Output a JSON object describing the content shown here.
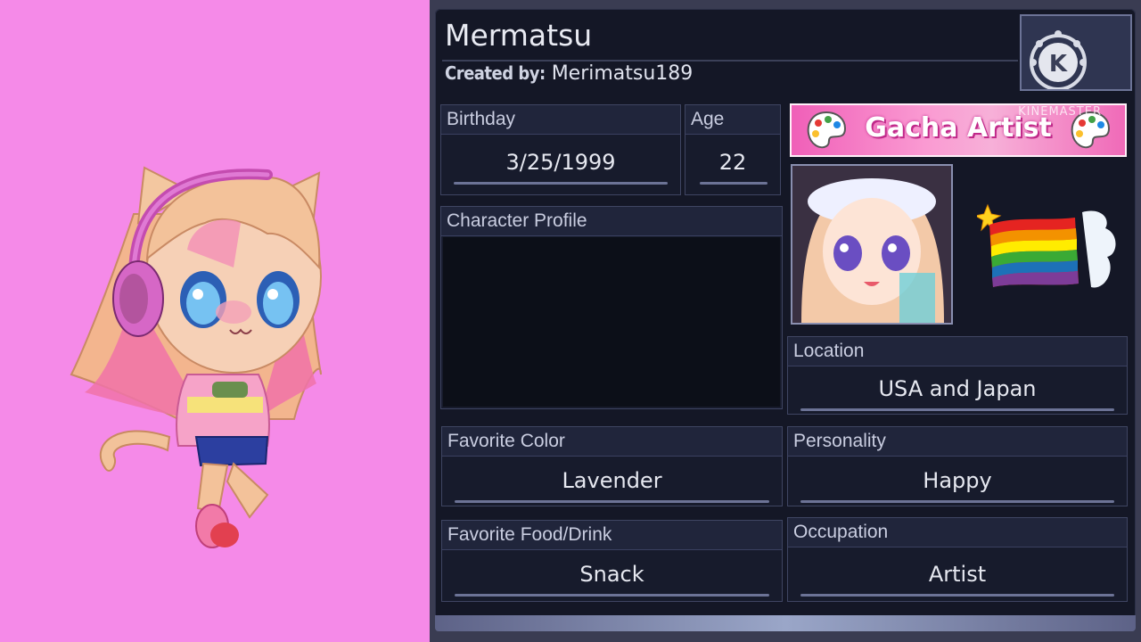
{
  "character": {
    "name": "Mermatsu",
    "created_by_label": "Created by:",
    "created_by": "Merimatsu189"
  },
  "fields": {
    "birthday": {
      "label": "Birthday",
      "value": "3/25/1999"
    },
    "age": {
      "label": "Age",
      "value": "22"
    },
    "profile": {
      "label": "Character Profile",
      "value": ""
    },
    "location": {
      "label": "Location",
      "value": "USA and Japan"
    },
    "favorite_color": {
      "label": "Favorite Color",
      "value": "Lavender"
    },
    "personality": {
      "label": "Personality",
      "value": "Happy"
    },
    "favorite_food": {
      "label": "Favorite Food/Drink",
      "value": "Snack"
    },
    "occupation": {
      "label": "Occupation",
      "value": "Artist"
    }
  },
  "banner": {
    "text": "Gacha Artist",
    "watermark": "KINEMASTER"
  },
  "logo": {
    "letter": "K"
  },
  "icons": [
    "palette-icon",
    "rainbow-flag-icon",
    "sparkle-icon",
    "kinemaster-logo-icon"
  ],
  "colors": {
    "background": "#f58ae8",
    "panel": "#141726",
    "field_border": "#3f4562",
    "accent": "#6c7396"
  }
}
